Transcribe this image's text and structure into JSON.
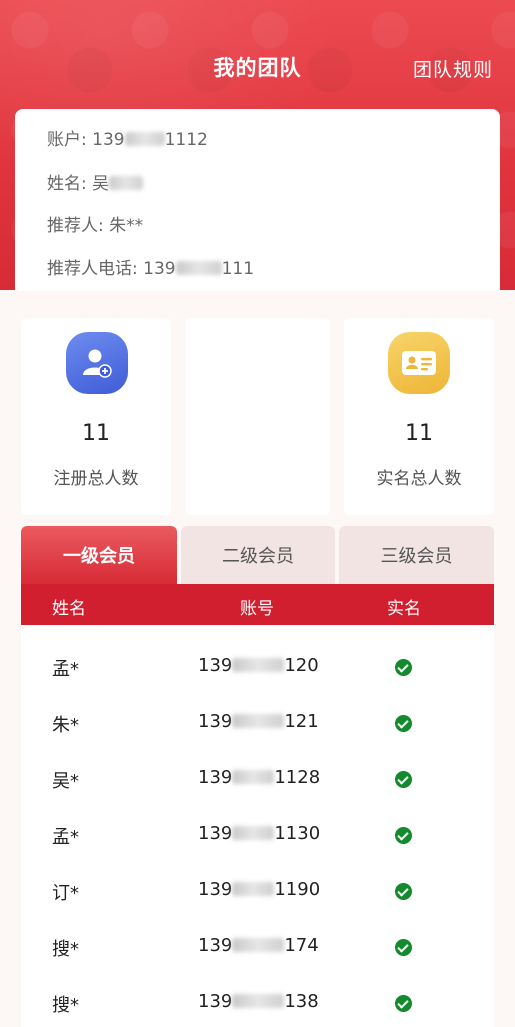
{
  "header": {
    "title": "我的团队",
    "rules_link": "团队规则"
  },
  "account_info": {
    "account_label": "账户:",
    "account_value_prefix": "139",
    "account_value_suffix": "1112",
    "name_label": "姓名:",
    "name_value": "吴",
    "referrer_label": "推荐人:",
    "referrer_value": "朱**",
    "referrer_phone_label": "推荐人电话:",
    "referrer_phone_prefix": "139",
    "referrer_phone_suffix": "111"
  },
  "stats": {
    "registered": {
      "value": "11",
      "label": "注册总人数",
      "icon": "user-add-icon",
      "color": "#4f6fe0"
    },
    "verified": {
      "value": "11",
      "label": "实名总人数",
      "icon": "id-card-icon",
      "color": "#f2bd43"
    }
  },
  "tabs": [
    {
      "label": "一级会员",
      "active": true
    },
    {
      "label": "二级会员",
      "active": false
    },
    {
      "label": "三级会员",
      "active": false
    }
  ],
  "table": {
    "columns": [
      "姓名",
      "账号",
      "实名"
    ],
    "rows": [
      {
        "name": "孟*",
        "acc_prefix": "139",
        "acc_suffix": "120",
        "verified": true
      },
      {
        "name": "朱*",
        "acc_prefix": "139",
        "acc_suffix": "121",
        "verified": true
      },
      {
        "name": "吴*",
        "acc_prefix": "139",
        "acc_suffix": "1128",
        "verified": true
      },
      {
        "name": "孟*",
        "acc_prefix": "139",
        "acc_suffix": "1130",
        "verified": true
      },
      {
        "name": "订*",
        "acc_prefix": "139",
        "acc_suffix": "1190",
        "verified": true
      },
      {
        "name": "搜*",
        "acc_prefix": "139",
        "acc_suffix": "174",
        "verified": true
      },
      {
        "name": "搜*",
        "acc_prefix": "139",
        "acc_suffix": "138",
        "verified": true
      }
    ]
  },
  "colors": {
    "primary": "#d72b37",
    "header_red": "#e0353f",
    "check_green": "#138a2e"
  }
}
